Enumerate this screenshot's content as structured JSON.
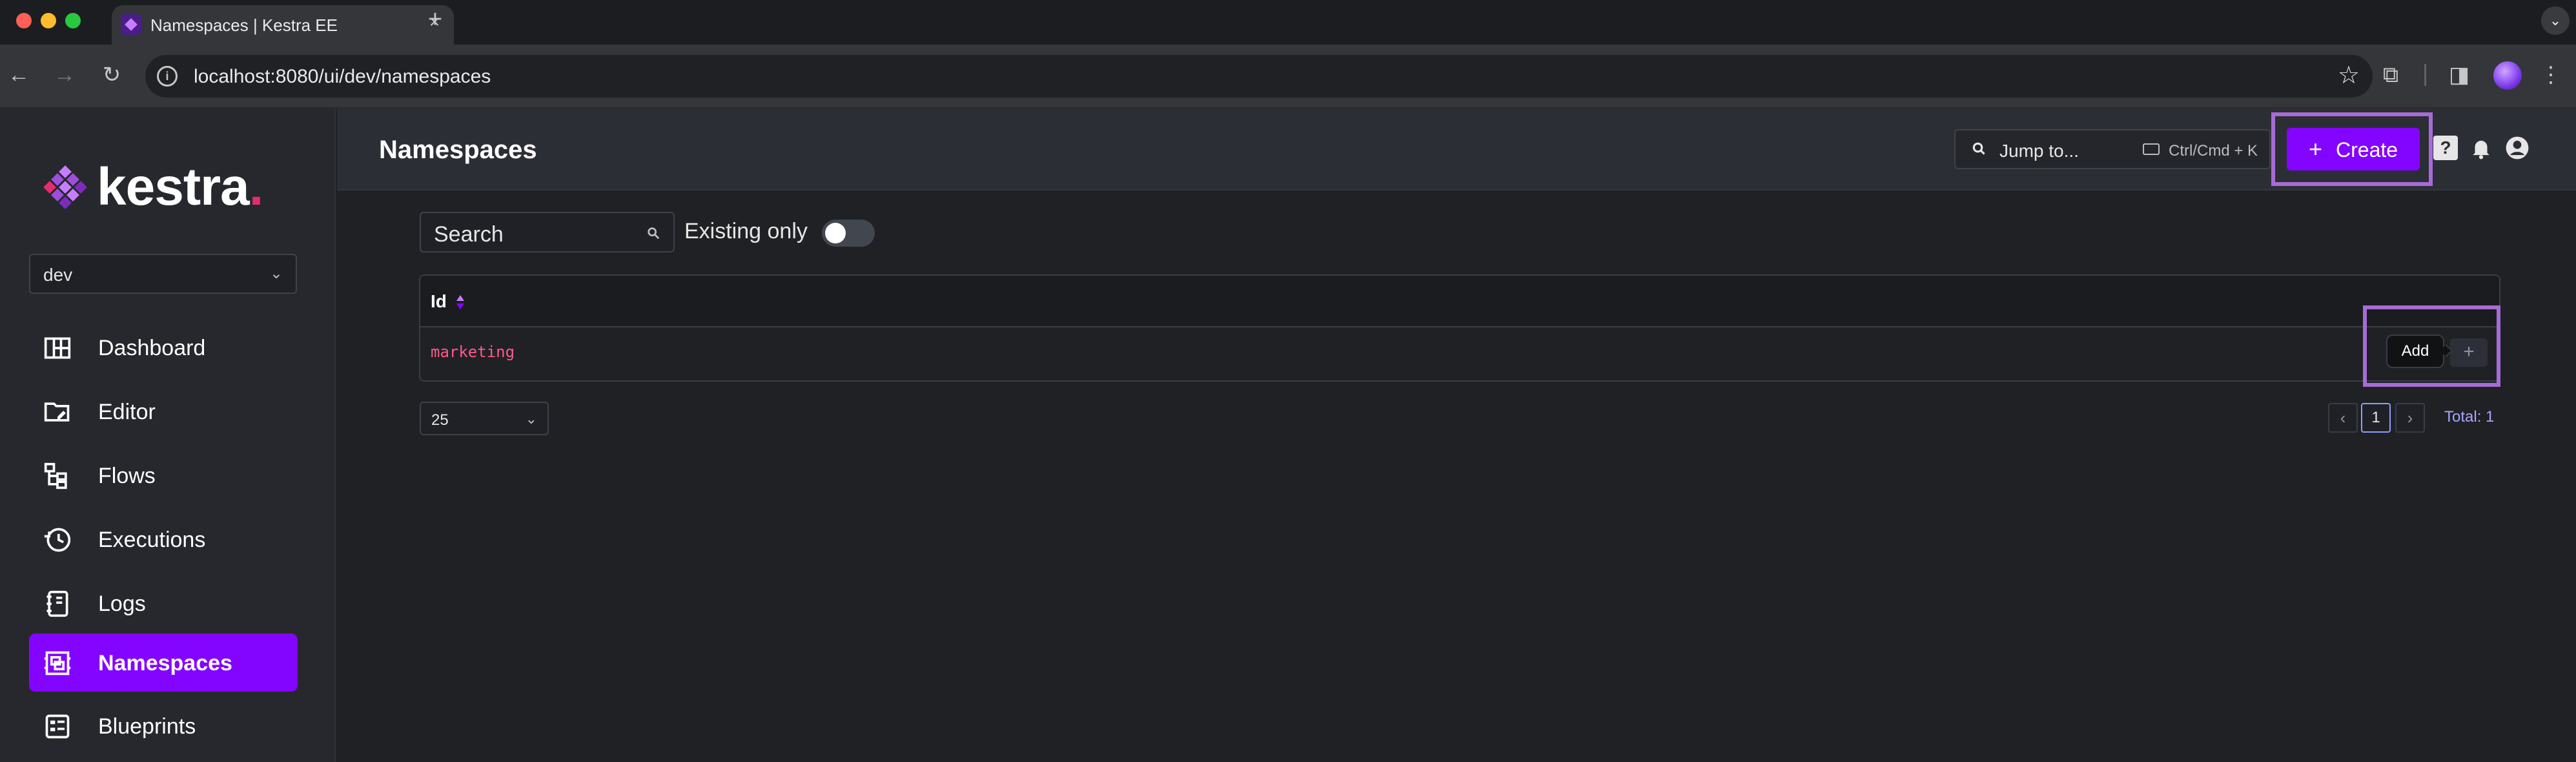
{
  "browser": {
    "tab_title": "Namespaces | Kestra EE",
    "url": "localhost:8080/ui/dev/namespaces"
  },
  "sidebar": {
    "logo_text": "kestra",
    "logo_dot": ".",
    "tenant": "dev",
    "items": [
      {
        "label": "Dashboard",
        "icon": "dashboard-icon",
        "active": false
      },
      {
        "label": "Editor",
        "icon": "folder-edit-icon",
        "active": false
      },
      {
        "label": "Flows",
        "icon": "flows-icon",
        "active": false
      },
      {
        "label": "Executions",
        "icon": "history-icon",
        "active": false
      },
      {
        "label": "Logs",
        "icon": "notebook-icon",
        "active": false
      },
      {
        "label": "Namespaces",
        "icon": "namespaces-icon",
        "active": true
      },
      {
        "label": "Blueprints",
        "icon": "blueprints-icon",
        "active": false
      }
    ]
  },
  "header": {
    "title": "Namespaces",
    "jump_placeholder": "Jump to...",
    "jump_shortcut": "Ctrl/Cmd + K",
    "create_label": "Create",
    "help_label": "?"
  },
  "filters": {
    "search_placeholder": "Search",
    "existing_only_label": "Existing only",
    "existing_only": false
  },
  "table": {
    "columns": [
      "Id"
    ],
    "rows": [
      {
        "id": "marketing"
      }
    ],
    "add_tooltip": "Add"
  },
  "pagination": {
    "per_page": "25",
    "current_page": "1",
    "total": "Total: 1"
  },
  "colors": {
    "accent": "#8405ff",
    "highlight": "#a86bd6",
    "namespace_id": "#ff5a8a",
    "logo_dot": "#e72b6d"
  }
}
